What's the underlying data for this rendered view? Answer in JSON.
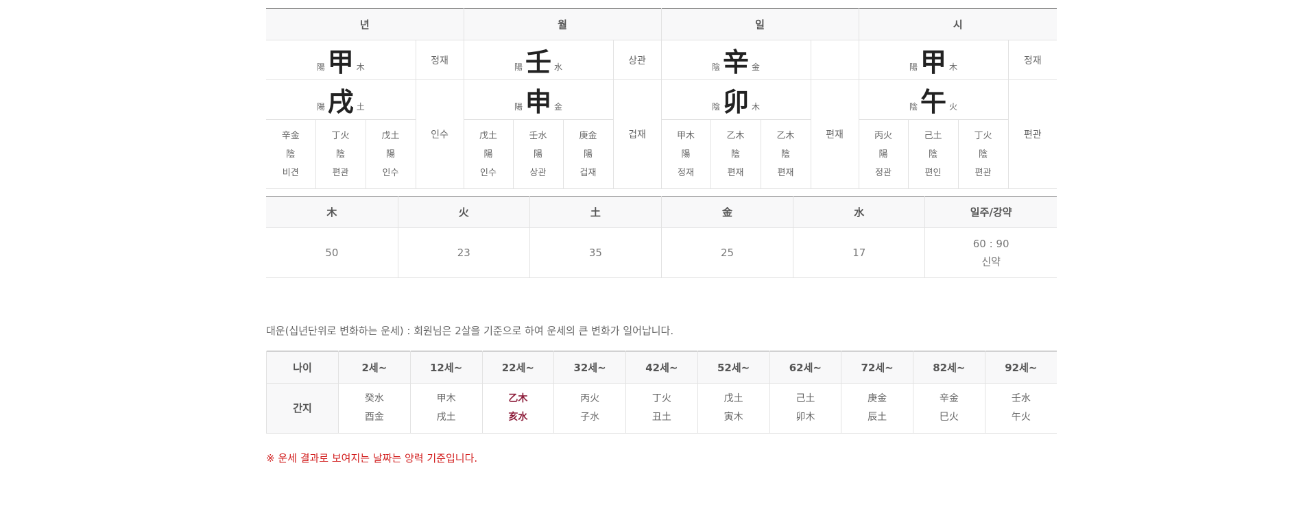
{
  "pillars": {
    "headers": [
      "년",
      "월",
      "일",
      "시"
    ],
    "heavenly": [
      {
        "yy": "陽",
        "char": "甲",
        "el": "木",
        "ten": "정재"
      },
      {
        "yy": "陽",
        "char": "壬",
        "el": "水",
        "ten": "상관"
      },
      {
        "yy": "陰",
        "char": "辛",
        "el": "金",
        "ten": ""
      },
      {
        "yy": "陽",
        "char": "甲",
        "el": "木",
        "ten": "정재"
      }
    ],
    "earthly": [
      {
        "yy": "陽",
        "char": "戌",
        "el": "土",
        "ten": "인수",
        "hidden": [
          [
            "辛金",
            "陰",
            "비견"
          ],
          [
            "丁火",
            "陰",
            "편관"
          ],
          [
            "戊土",
            "陽",
            "인수"
          ]
        ]
      },
      {
        "yy": "陽",
        "char": "申",
        "el": "金",
        "ten": "겁재",
        "hidden": [
          [
            "戊土",
            "陽",
            "인수"
          ],
          [
            "壬水",
            "陽",
            "상관"
          ],
          [
            "庚金",
            "陽",
            "겁재"
          ]
        ]
      },
      {
        "yy": "陰",
        "char": "卯",
        "el": "木",
        "ten": "편재",
        "hidden": [
          [
            "甲木",
            "陽",
            "정재"
          ],
          [
            "乙木",
            "陰",
            "편재"
          ],
          [
            "乙木",
            "陰",
            "편재"
          ]
        ]
      },
      {
        "yy": "陰",
        "char": "午",
        "el": "火",
        "ten": "편관",
        "hidden": [
          [
            "丙火",
            "陽",
            "정관"
          ],
          [
            "己土",
            "陰",
            "편인"
          ],
          [
            "丁火",
            "陰",
            "편관"
          ]
        ]
      }
    ]
  },
  "elements": {
    "headers": [
      "木",
      "火",
      "土",
      "金",
      "水",
      "일주/강약"
    ],
    "values": [
      "50",
      "23",
      "35",
      "25",
      "17"
    ],
    "strength_ratio": "60 : 90",
    "strength_label": "신약"
  },
  "daewoon": {
    "description": "대운(십년단위로 변화하는 운세) : 회원님은 2살을 기준으로 하여 운세의 큰 변화가 일어납니다.",
    "age_label": "나이",
    "ganji_label": "간지",
    "active_index": 2,
    "columns": [
      {
        "age": "2세~",
        "stem": "癸水",
        "branch": "酉金"
      },
      {
        "age": "12세~",
        "stem": "甲木",
        "branch": "戌土"
      },
      {
        "age": "22세~",
        "stem": "乙木",
        "branch": "亥水"
      },
      {
        "age": "32세~",
        "stem": "丙火",
        "branch": "子水"
      },
      {
        "age": "42세~",
        "stem": "丁火",
        "branch": "丑土"
      },
      {
        "age": "52세~",
        "stem": "戊土",
        "branch": "寅木"
      },
      {
        "age": "62세~",
        "stem": "己土",
        "branch": "卯木"
      },
      {
        "age": "72세~",
        "stem": "庚金",
        "branch": "辰土"
      },
      {
        "age": "82세~",
        "stem": "辛金",
        "branch": "巳火"
      },
      {
        "age": "92세~",
        "stem": "壬水",
        "branch": "午火"
      }
    ],
    "colors": {
      "active": "#8e1f3c"
    }
  },
  "note": "※ 운세 결과로 보여지는 날짜는 양력 기준입니다.",
  "colors": {
    "note": "#d21e1e",
    "header_bg": "#f8f8f9"
  }
}
